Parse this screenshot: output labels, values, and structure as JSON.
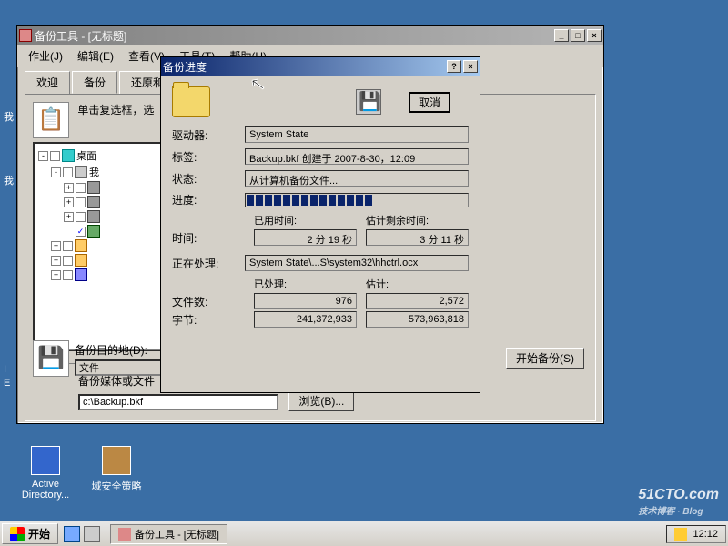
{
  "main_window": {
    "title": "备份工具 - [无标题]",
    "menu": [
      "作业(J)",
      "编辑(E)",
      "查看(V)",
      "工具(T)",
      "帮助(H)"
    ],
    "tabs": [
      {
        "label": "欢迎",
        "active": false
      },
      {
        "label": "备份",
        "active": true
      },
      {
        "label": "还原和"
      }
    ],
    "instruction": "单击复选框，选",
    "tree": [
      {
        "indent": 0,
        "expand": "-",
        "checked": false,
        "icon": "ico-desktop",
        "label": "桌面"
      },
      {
        "indent": 1,
        "expand": "-",
        "checked": false,
        "icon": "ico-computer",
        "label": "我"
      },
      {
        "indent": 2,
        "expand": "+",
        "checked": false,
        "icon": "ico-drive",
        "label": ""
      },
      {
        "indent": 2,
        "expand": "+",
        "checked": false,
        "icon": "ico-drive",
        "label": ""
      },
      {
        "indent": 2,
        "expand": "+",
        "checked": false,
        "icon": "ico-drive",
        "label": ""
      },
      {
        "indent": 2,
        "expand": "",
        "checked": true,
        "icon": "ico-sys",
        "label": ""
      },
      {
        "indent": 1,
        "expand": "+",
        "checked": false,
        "icon": "ico-folder",
        "label": ""
      },
      {
        "indent": 1,
        "expand": "+",
        "checked": false,
        "icon": "ico-folder",
        "label": ""
      },
      {
        "indent": 1,
        "expand": "+",
        "checked": false,
        "icon": "ico-net",
        "label": ""
      }
    ],
    "dest_label": "备份目的地(D):",
    "dest_value": "文件",
    "media_label": "备份媒体或文件",
    "media_value": "c:\\Backup.bkf",
    "browse_btn": "浏览(B)...",
    "start_backup": "开始备份(S)"
  },
  "progress_dialog": {
    "title": "备份进度",
    "cancel_btn": "取消",
    "rows": {
      "drive_label": "驱动器:",
      "drive_value": "System State",
      "tag_label": "标签:",
      "tag_value": "Backup.bkf 创建于 2007-8-30，12:09",
      "status_label": "状态:",
      "status_value": "从计算机备份文件...",
      "progress_label": "进度:",
      "processing_label": "正在处理:",
      "processing_value": "System State\\...S\\system32\\hhctrl.ocx"
    },
    "time": {
      "row_label": "时间:",
      "elapsed_header": "已用时间:",
      "elapsed_value": "2 分 19 秒",
      "remain_header": "估计剩余时间:",
      "remain_value": "3 分 11 秒"
    },
    "stats": {
      "processed_header": "已处理:",
      "estimate_header": "估计:",
      "files_label": "文件数:",
      "files_processed": "976",
      "files_estimate": "2,572",
      "bytes_label": "字节:",
      "bytes_processed": "241,372,933",
      "bytes_estimate": "573,963,818"
    },
    "progress_segments": 14
  },
  "desktop_icons": [
    {
      "label": "Active Directory..."
    },
    {
      "label": "域安全策略"
    }
  ],
  "taskbar": {
    "start": "开始",
    "task_button": "备份工具 - [无标题]",
    "clock": "12:12"
  },
  "left_labels": [
    "我",
    "我",
    "I",
    "E"
  ],
  "watermark": {
    "main": "51CTO.com",
    "sub": "技术博客 · Blog"
  }
}
